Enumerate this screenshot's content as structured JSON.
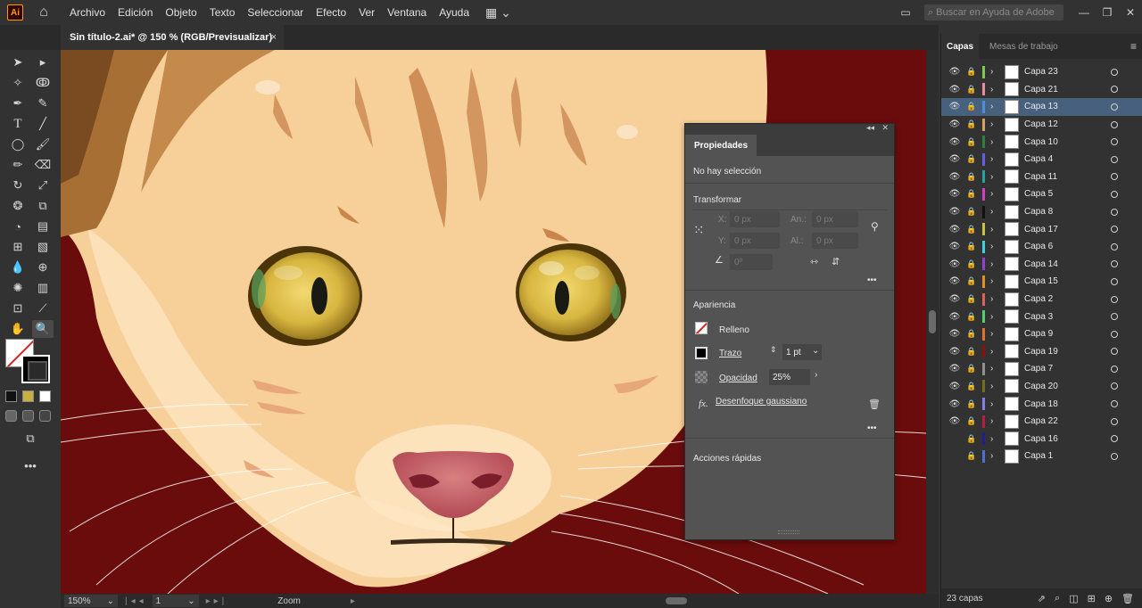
{
  "app": {
    "logo": "Ai",
    "menu": [
      "Archivo",
      "Edición",
      "Objeto",
      "Texto",
      "Seleccionar",
      "Efecto",
      "Ver",
      "Ventana",
      "Ayuda"
    ],
    "search_placeholder": "Buscar en Ayuda de Adobe"
  },
  "document_tab": {
    "title": "Sin título-2.ai* @ 150 % (RGB/Previsualizar)",
    "close": "×"
  },
  "status": {
    "zoom": "150%",
    "page": "1",
    "tool": "Zoom"
  },
  "properties": {
    "title": "Propiedades",
    "no_selection": "No hay selección",
    "transform_label": "Transformar",
    "x_label": "X:",
    "y_label": "Y:",
    "w_label": "An.:",
    "h_label": "Al.:",
    "x_value": "0 px",
    "y_value": "0 px",
    "w_value": "0 px",
    "h_value": "0 px",
    "angle_value": "0º",
    "appearance_label": "Apariencia",
    "fill_label": "Relleno",
    "stroke_label": "Trazo",
    "stroke_value": "1 pt",
    "opacity_label": "Opacidad",
    "opacity_value": "25%",
    "effect_label": "Desenfoque gaussiano",
    "quick_actions_label": "Acciones rápidas",
    "more": "•••"
  },
  "layers_panel": {
    "tab_layers": "Capas",
    "tab_artboards": "Mesas de trabajo",
    "count_label": "23 capas",
    "layers": [
      {
        "name": "Capa 23",
        "color": "#7ec850",
        "visible": true,
        "selected": false
      },
      {
        "name": "Capa 21",
        "color": "#e88aa0",
        "visible": true,
        "selected": false
      },
      {
        "name": "Capa 13",
        "color": "#4f8fd8",
        "visible": true,
        "selected": true
      },
      {
        "name": "Capa 12",
        "color": "#d8a060",
        "visible": true,
        "selected": false
      },
      {
        "name": "Capa 10",
        "color": "#2f8040",
        "visible": true,
        "selected": false
      },
      {
        "name": "Capa 4",
        "color": "#6060e0",
        "visible": true,
        "selected": false
      },
      {
        "name": "Capa 11",
        "color": "#2aa0a0",
        "visible": true,
        "selected": false
      },
      {
        "name": "Capa 5",
        "color": "#d040c0",
        "visible": true,
        "selected": false
      },
      {
        "name": "Capa 8",
        "color": "#111111",
        "visible": true,
        "selected": false
      },
      {
        "name": "Capa 17",
        "color": "#c8c040",
        "visible": true,
        "selected": false
      },
      {
        "name": "Capa 6",
        "color": "#40d0e0",
        "visible": true,
        "selected": false
      },
      {
        "name": "Capa 14",
        "color": "#9040d0",
        "visible": true,
        "selected": false
      },
      {
        "name": "Capa 15",
        "color": "#e09020",
        "visible": true,
        "selected": false
      },
      {
        "name": "Capa 2",
        "color": "#e06060",
        "visible": true,
        "selected": false
      },
      {
        "name": "Capa 3",
        "color": "#50d070",
        "visible": true,
        "selected": false
      },
      {
        "name": "Capa 9",
        "color": "#e07030",
        "visible": true,
        "selected": false
      },
      {
        "name": "Capa 19",
        "color": "#8a1010",
        "visible": true,
        "selected": false
      },
      {
        "name": "Capa 7",
        "color": "#909090",
        "visible": true,
        "selected": false
      },
      {
        "name": "Capa 20",
        "color": "#707020",
        "visible": true,
        "selected": false
      },
      {
        "name": "Capa 18",
        "color": "#8080e0",
        "visible": true,
        "selected": false
      },
      {
        "name": "Capa 22",
        "color": "#b02040",
        "visible": true,
        "selected": false
      },
      {
        "name": "Capa 16",
        "color": "#202090",
        "visible": false,
        "selected": false
      },
      {
        "name": "Capa 1",
        "color": "#5070d0",
        "visible": false,
        "selected": false
      }
    ]
  }
}
